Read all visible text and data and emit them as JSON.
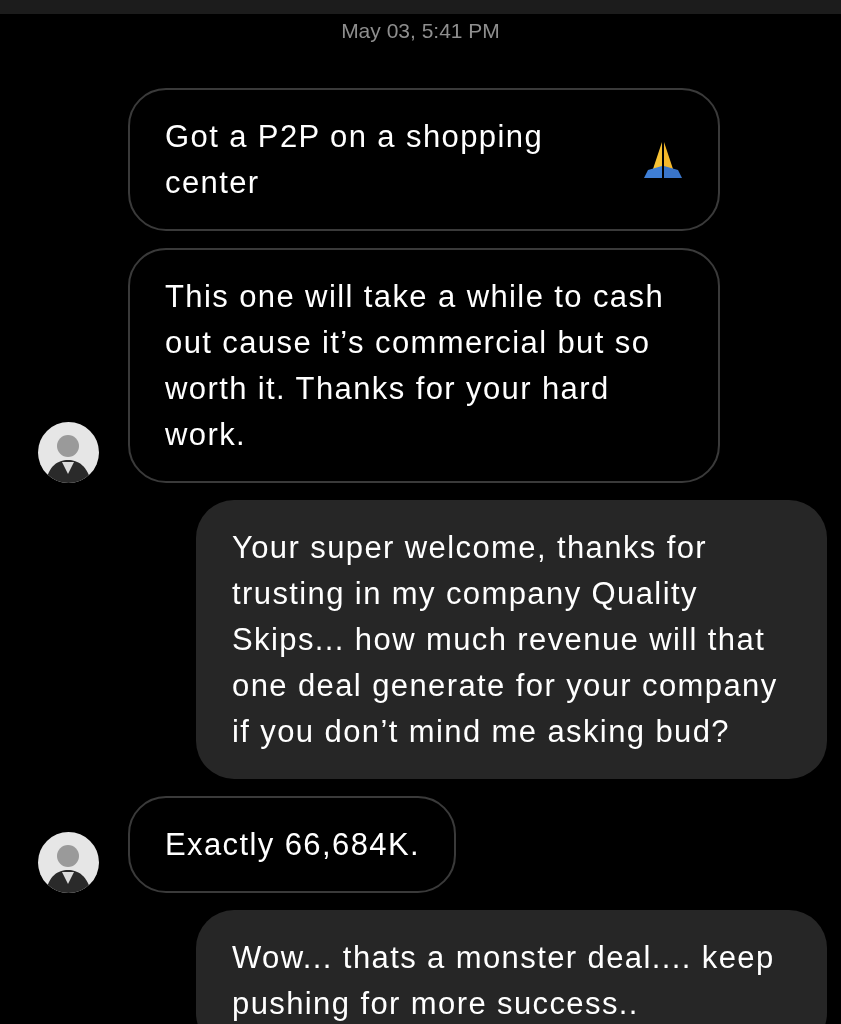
{
  "timestamp": "May 03, 5:41 PM",
  "messages": [
    {
      "kind": "in",
      "text": "Got a P2P on a shopping center",
      "praying_icon": true,
      "show_avatar": false
    },
    {
      "kind": "in",
      "text": "This one will take a while to cash out cause it’s commercial but so worth it. Thanks for your hard work.",
      "show_avatar": true
    },
    {
      "kind": "out",
      "text": "Your super welcome, thanks for trusting in my company Quality Skips... how much revenue will that one deal generate for your company if you don’t mind me asking bud?"
    },
    {
      "kind": "in",
      "text": "Exactly 66,684K.",
      "show_avatar": true
    },
    {
      "kind": "out",
      "text": "Wow... thats a monster deal.... keep pushing for more success.."
    }
  ]
}
